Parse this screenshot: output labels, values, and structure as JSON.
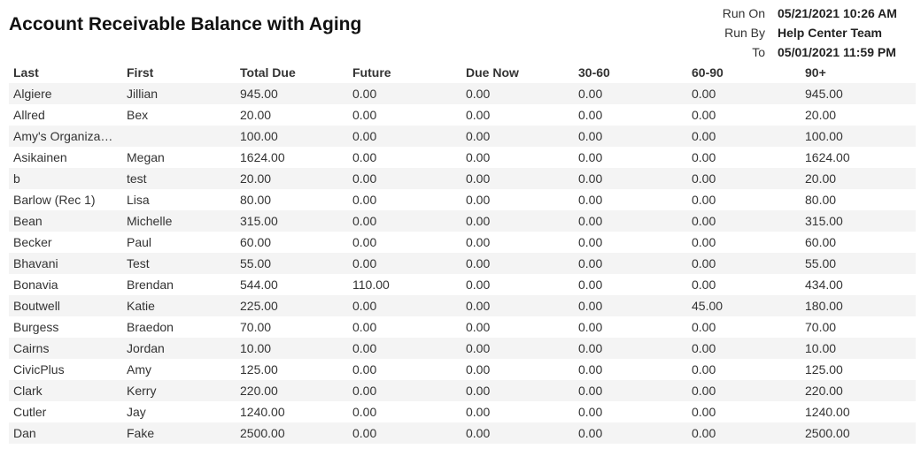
{
  "report": {
    "title": "Account Receivable Balance with Aging",
    "meta": [
      {
        "label": "Run On",
        "value": "05/21/2021 10:26 AM"
      },
      {
        "label": "Run By",
        "value": "Help Center Team"
      },
      {
        "label": "To",
        "value": "05/01/2021 11:59 PM"
      }
    ]
  },
  "table": {
    "columns": [
      "Last",
      "First",
      "Total Due",
      "Future",
      "Due Now",
      "30-60",
      "60-90",
      "90+"
    ],
    "rows": [
      [
        "Algiere",
        "Jillian",
        "945.00",
        "0.00",
        "0.00",
        "0.00",
        "0.00",
        "945.00"
      ],
      [
        "Allred",
        "Bex",
        "20.00",
        "0.00",
        "0.00",
        "0.00",
        "0.00",
        "20.00"
      ],
      [
        "Amy's Organiza…",
        "",
        "100.00",
        "0.00",
        "0.00",
        "0.00",
        "0.00",
        "100.00"
      ],
      [
        "Asikainen",
        "Megan",
        "1624.00",
        "0.00",
        "0.00",
        "0.00",
        "0.00",
        "1624.00"
      ],
      [
        "b",
        "test",
        "20.00",
        "0.00",
        "0.00",
        "0.00",
        "0.00",
        "20.00"
      ],
      [
        "Barlow (Rec 1)",
        "Lisa",
        "80.00",
        "0.00",
        "0.00",
        "0.00",
        "0.00",
        "80.00"
      ],
      [
        "Bean",
        "Michelle",
        "315.00",
        "0.00",
        "0.00",
        "0.00",
        "0.00",
        "315.00"
      ],
      [
        "Becker",
        "Paul",
        "60.00",
        "0.00",
        "0.00",
        "0.00",
        "0.00",
        "60.00"
      ],
      [
        "Bhavani",
        "Test",
        "55.00",
        "0.00",
        "0.00",
        "0.00",
        "0.00",
        "55.00"
      ],
      [
        "Bonavia",
        "Brendan",
        "544.00",
        "110.00",
        "0.00",
        "0.00",
        "0.00",
        "434.00"
      ],
      [
        "Boutwell",
        "Katie",
        "225.00",
        "0.00",
        "0.00",
        "0.00",
        "45.00",
        "180.00"
      ],
      [
        "Burgess",
        "Braedon",
        "70.00",
        "0.00",
        "0.00",
        "0.00",
        "0.00",
        "70.00"
      ],
      [
        "Cairns",
        "Jordan",
        "10.00",
        "0.00",
        "0.00",
        "0.00",
        "0.00",
        "10.00"
      ],
      [
        "CivicPlus",
        "Amy",
        "125.00",
        "0.00",
        "0.00",
        "0.00",
        "0.00",
        "125.00"
      ],
      [
        "Clark",
        "Kerry",
        "220.00",
        "0.00",
        "0.00",
        "0.00",
        "0.00",
        "220.00"
      ],
      [
        "Cutler",
        "Jay",
        "1240.00",
        "0.00",
        "0.00",
        "0.00",
        "0.00",
        "1240.00"
      ],
      [
        "Dan",
        "Fake",
        "2500.00",
        "0.00",
        "0.00",
        "0.00",
        "0.00",
        "2500.00"
      ]
    ]
  }
}
